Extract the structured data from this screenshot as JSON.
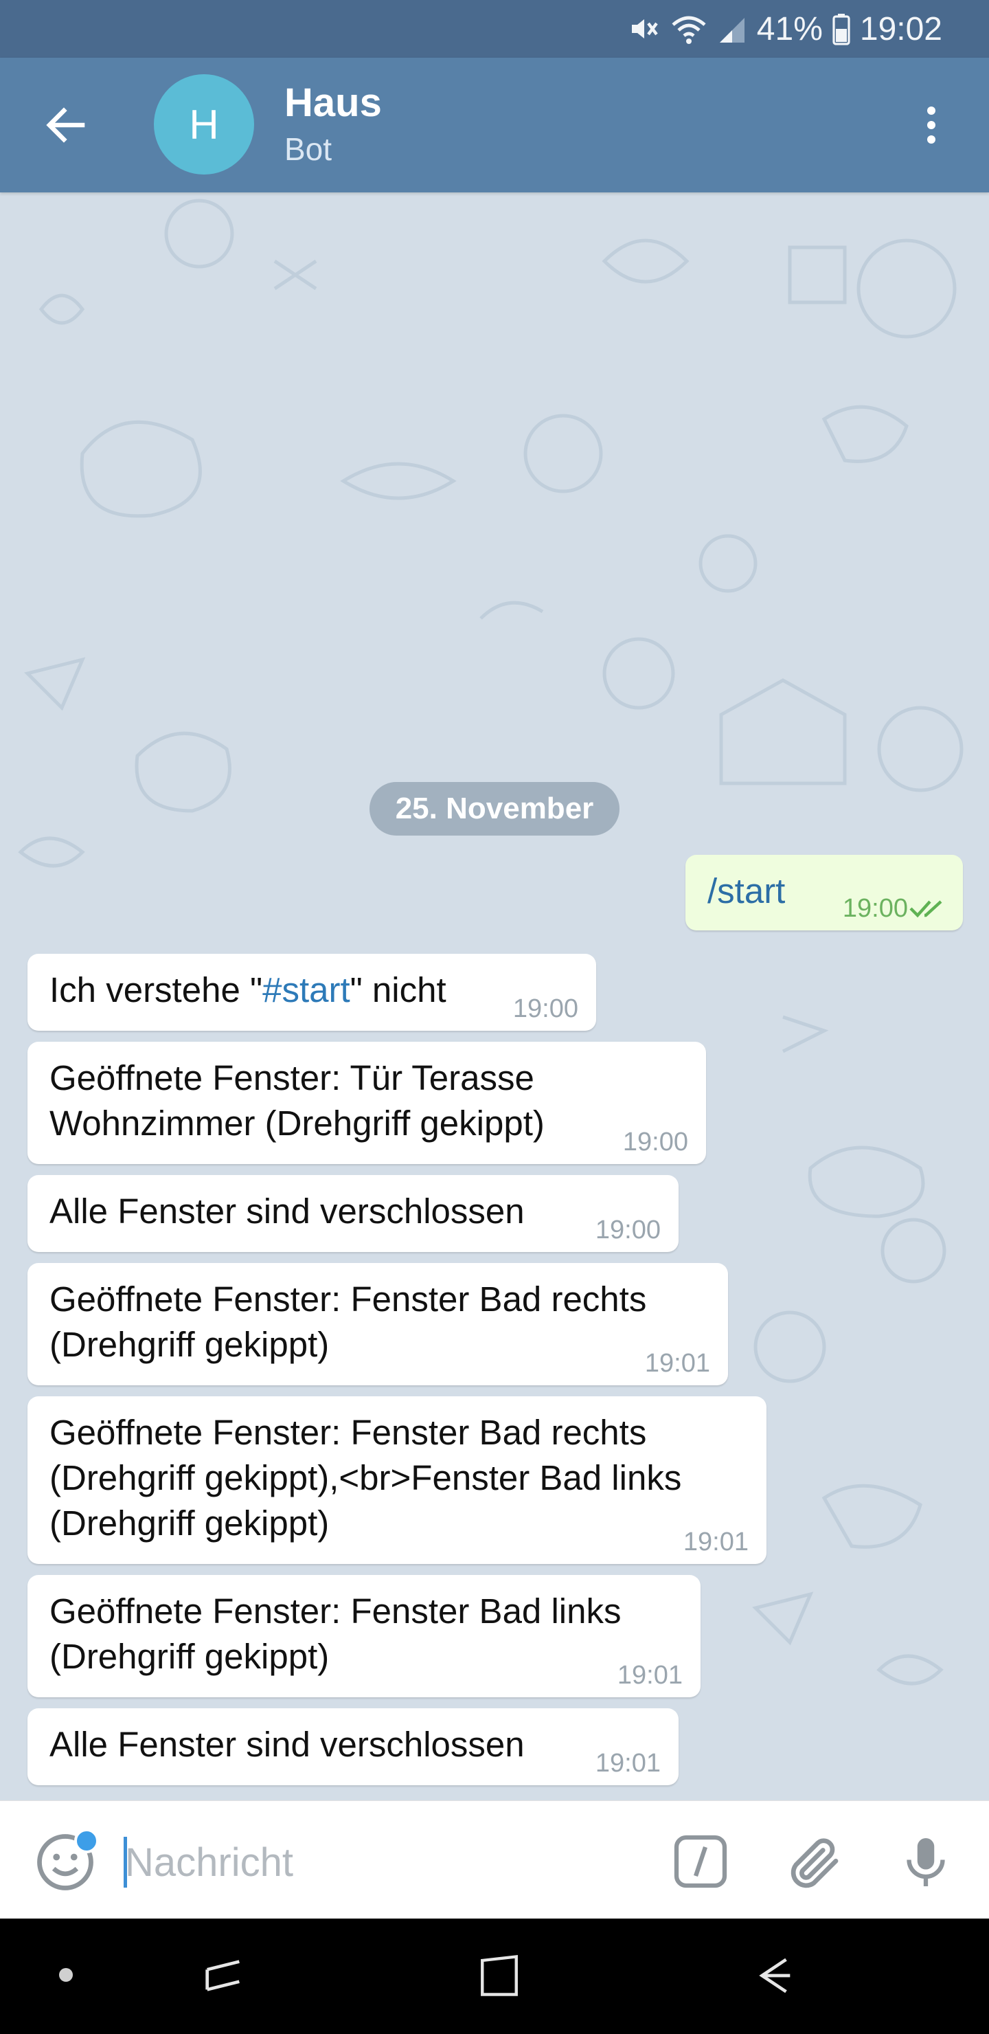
{
  "status_bar": {
    "battery": "41%",
    "time": "19:02",
    "icons": [
      "mute-icon",
      "wifi-icon",
      "signal-icon",
      "battery-icon"
    ]
  },
  "header": {
    "avatar_letter": "H",
    "title": "Haus",
    "subtitle": "Bot",
    "colors": {
      "bar": "#5881a8",
      "avatar": "#5bbcd6"
    }
  },
  "chat": {
    "date_separator": "25. November",
    "outgoing": {
      "text": "/start",
      "time": "19:00"
    },
    "messages": [
      {
        "pre": "Ich verstehe \"",
        "link": "#start",
        "post": "\" nicht",
        "time": "19:00"
      },
      {
        "text": "Geöffnete Fenster: Tür Terasse\nWohnzimmer (Drehgriff gekippt)",
        "time": "19:00"
      },
      {
        "text": "Alle Fenster sind verschlossen",
        "time": "19:00"
      },
      {
        "text": "Geöffnete Fenster: Fenster Bad rechts\n(Drehgriff gekippt)",
        "time": "19:01"
      },
      {
        "text": "Geöffnete Fenster: Fenster Bad rechts\n(Drehgriff gekippt),<br>Fenster Bad links\n(Drehgriff gekippt)",
        "time": "19:01"
      },
      {
        "text": "Geöffnete Fenster: Fenster Bad links\n(Drehgriff gekippt)",
        "time": "19:01"
      },
      {
        "text": "Alle Fenster sind verschlossen",
        "time": "19:01"
      }
    ]
  },
  "input": {
    "placeholder": "Nachricht",
    "value": ""
  }
}
